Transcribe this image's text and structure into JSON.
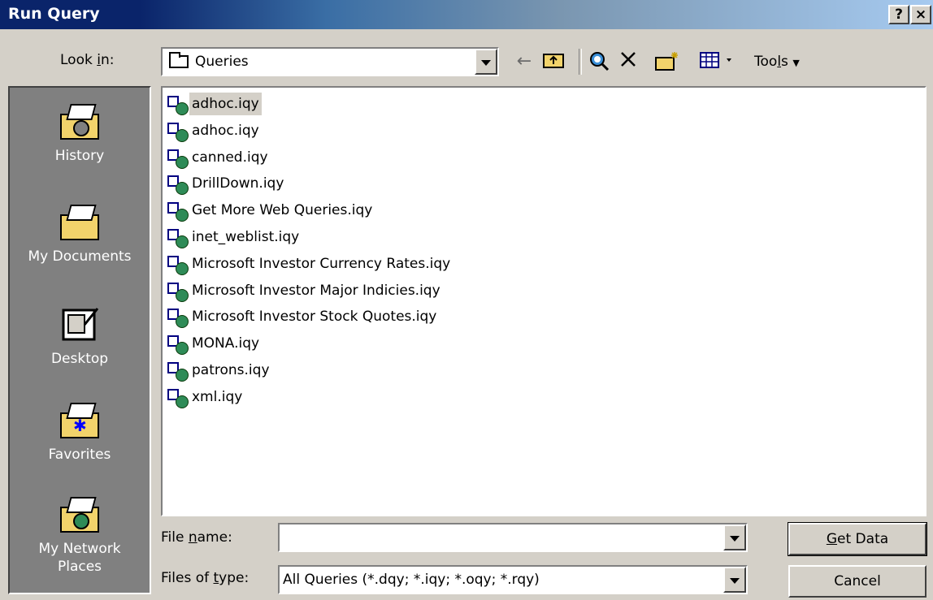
{
  "window": {
    "title": "Run Query",
    "help": "?",
    "close": "×"
  },
  "lookin": {
    "label_pre": "Look ",
    "label_u": "i",
    "label_post": "n:",
    "value": "Queries"
  },
  "toolbar": {
    "tools_pre": "Too",
    "tools_u": "l",
    "tools_post": "s"
  },
  "places": [
    {
      "label": "History"
    },
    {
      "label": "My Documents"
    },
    {
      "label": "Desktop"
    },
    {
      "label": "Favorites"
    },
    {
      "label": "My Network Places"
    }
  ],
  "files": [
    "adhoc.iqy",
    "adhoc.iqy",
    "canned.iqy",
    "DrillDown.iqy",
    "Get More Web Queries.iqy",
    "inet_weblist.iqy",
    "Microsoft Investor Currency Rates.iqy",
    "Microsoft Investor Major Indicies.iqy",
    "Microsoft Investor Stock Quotes.iqy",
    "MONA.iqy",
    "patrons.iqy",
    "xml.iqy"
  ],
  "filename": {
    "label_pre": "File ",
    "label_u": "n",
    "label_post": "ame:",
    "value": ""
  },
  "filetype": {
    "label_pre": "Files of ",
    "label_u": "t",
    "label_post": "ype:",
    "value": "All Queries (*.dqy; *.iqy; *.oqy; *.rqy)"
  },
  "buttons": {
    "get_u": "G",
    "get_post": "et Data",
    "cancel": "Cancel"
  }
}
